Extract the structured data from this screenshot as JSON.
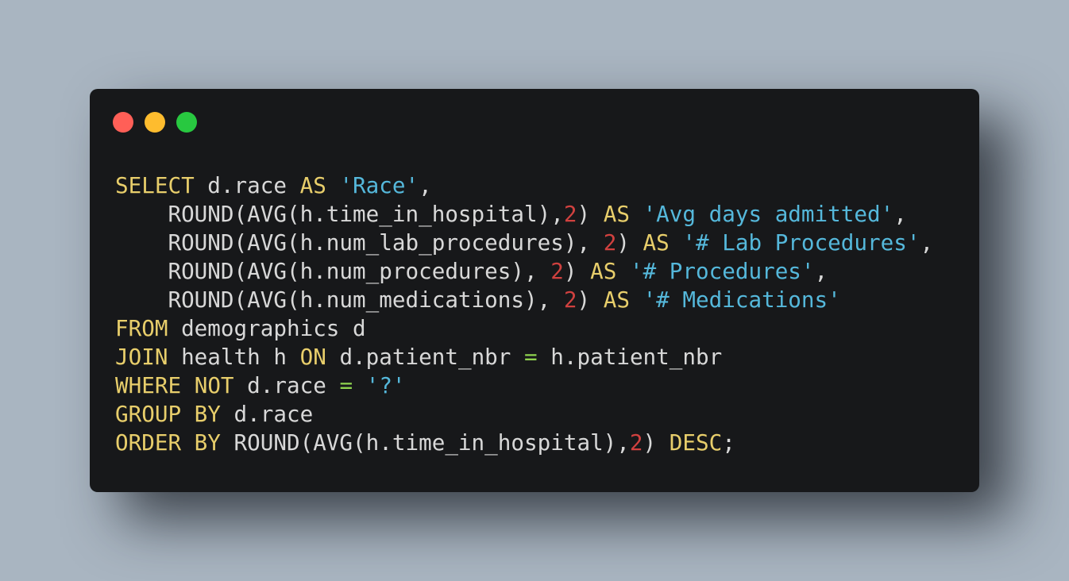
{
  "window": {
    "buttons": [
      {
        "name": "close",
        "color": "#ff5f57"
      },
      {
        "name": "minimize",
        "color": "#febc2e"
      },
      {
        "name": "maximize",
        "color": "#28c840"
      }
    ]
  },
  "colors": {
    "keyword": "#e8ce6b",
    "identifier": "#d8d8d8",
    "string": "#55b8db",
    "number": "#d0413f",
    "operator": "#8fd34f",
    "background": "#17181a",
    "page": "#a9b5c1"
  },
  "code": {
    "lines": [
      [
        {
          "t": "kw",
          "v": "SELECT"
        },
        {
          "t": "id",
          "v": " d.race "
        },
        {
          "t": "kw",
          "v": "AS"
        },
        {
          "t": "id",
          "v": " "
        },
        {
          "t": "str",
          "v": "'Race'"
        },
        {
          "t": "pn",
          "v": ","
        }
      ],
      [
        {
          "t": "id",
          "v": "    ROUND(AVG(h.time_in_hospital),"
        },
        {
          "t": "num",
          "v": "2"
        },
        {
          "t": "id",
          "v": ") "
        },
        {
          "t": "kw",
          "v": "AS"
        },
        {
          "t": "id",
          "v": " "
        },
        {
          "t": "str",
          "v": "'Avg days admitted'"
        },
        {
          "t": "pn",
          "v": ","
        }
      ],
      [
        {
          "t": "id",
          "v": "    ROUND(AVG(h.num_lab_procedures), "
        },
        {
          "t": "num",
          "v": "2"
        },
        {
          "t": "id",
          "v": ") "
        },
        {
          "t": "kw",
          "v": "AS"
        },
        {
          "t": "id",
          "v": " "
        },
        {
          "t": "str",
          "v": "'# Lab Procedures'"
        },
        {
          "t": "pn",
          "v": ","
        }
      ],
      [
        {
          "t": "id",
          "v": "    ROUND(AVG(h.num_procedures), "
        },
        {
          "t": "num",
          "v": "2"
        },
        {
          "t": "id",
          "v": ") "
        },
        {
          "t": "kw",
          "v": "AS"
        },
        {
          "t": "id",
          "v": " "
        },
        {
          "t": "str",
          "v": "'# Procedures'"
        },
        {
          "t": "pn",
          "v": ","
        }
      ],
      [
        {
          "t": "id",
          "v": "    ROUND(AVG(h.num_medications), "
        },
        {
          "t": "num",
          "v": "2"
        },
        {
          "t": "id",
          "v": ") "
        },
        {
          "t": "kw",
          "v": "AS"
        },
        {
          "t": "id",
          "v": " "
        },
        {
          "t": "str",
          "v": "'# Medications'"
        }
      ],
      [
        {
          "t": "kw",
          "v": "FROM"
        },
        {
          "t": "id",
          "v": " demographics d"
        }
      ],
      [
        {
          "t": "kw",
          "v": "JOIN"
        },
        {
          "t": "id",
          "v": " health h "
        },
        {
          "t": "kw",
          "v": "ON"
        },
        {
          "t": "id",
          "v": " d.patient_nbr "
        },
        {
          "t": "op",
          "v": "="
        },
        {
          "t": "id",
          "v": " h.patient_nbr"
        }
      ],
      [
        {
          "t": "kw",
          "v": "WHERE"
        },
        {
          "t": "id",
          "v": " "
        },
        {
          "t": "kw",
          "v": "NOT"
        },
        {
          "t": "id",
          "v": " d.race "
        },
        {
          "t": "op",
          "v": "="
        },
        {
          "t": "id",
          "v": " "
        },
        {
          "t": "str",
          "v": "'?'"
        }
      ],
      [
        {
          "t": "kw",
          "v": "GROUP BY"
        },
        {
          "t": "id",
          "v": " d.race"
        }
      ],
      [
        {
          "t": "kw",
          "v": "ORDER BY"
        },
        {
          "t": "id",
          "v": " ROUND(AVG(h.time_in_hospital),"
        },
        {
          "t": "num",
          "v": "2"
        },
        {
          "t": "id",
          "v": ") "
        },
        {
          "t": "kw",
          "v": "DESC"
        },
        {
          "t": "pn",
          "v": ";"
        }
      ]
    ]
  }
}
